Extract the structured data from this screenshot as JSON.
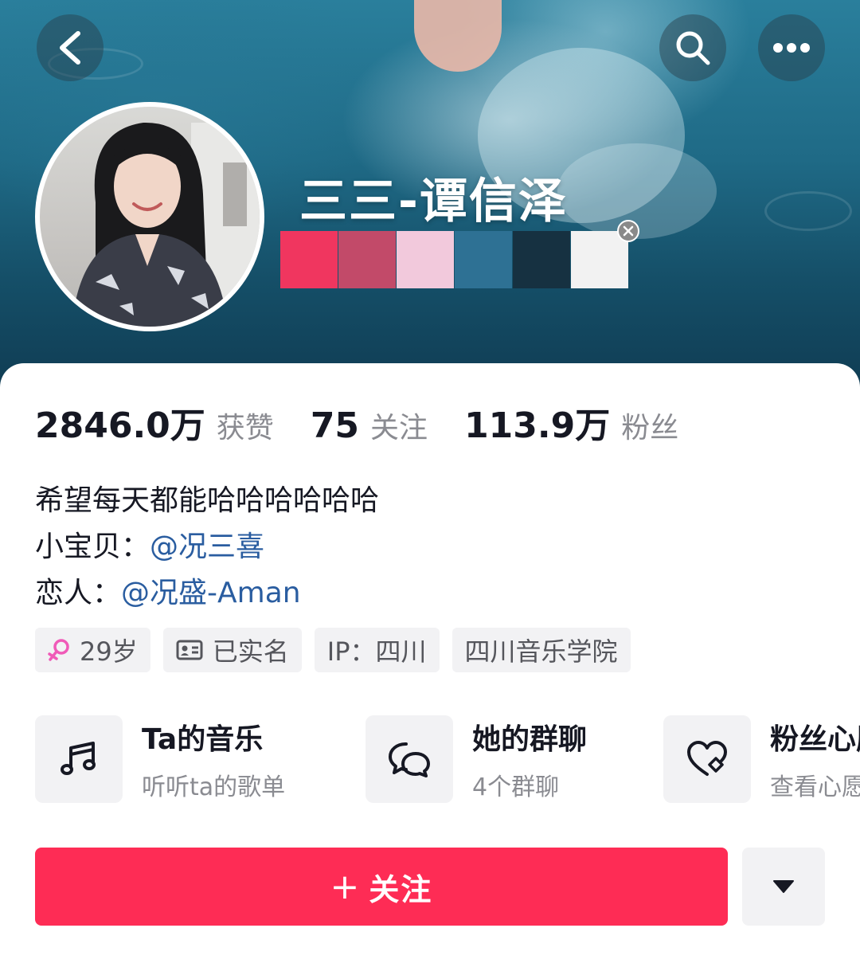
{
  "header": {
    "nickname": "三三-谭信泽",
    "palette": [
      "#f0365f",
      "#c24a69",
      "#f2c9dc",
      "#2e7194",
      "#163141",
      "#f2f2f2"
    ]
  },
  "stats": [
    {
      "value": "2846.0万",
      "label": "获赞"
    },
    {
      "value": "75",
      "label": "关注"
    },
    {
      "value": "113.9万",
      "label": "粉丝"
    }
  ],
  "bio": {
    "line1": "希望每天都能哈哈哈哈哈哈",
    "line2_prefix": "小宝贝：",
    "line2_mention": "@况三喜",
    "line3_prefix": "恋人：",
    "line3_mention": "@况盛-Aman"
  },
  "tags": {
    "age": "29岁",
    "verified": "已实名",
    "ip": "IP：四川",
    "school": "四川音乐学院"
  },
  "features": [
    {
      "title": "Ta的音乐",
      "subtitle": "听听ta的歌单",
      "icon": "music-note-icon"
    },
    {
      "title": "她的群聊",
      "subtitle": "4个群聊",
      "icon": "chat-bubbles-icon"
    },
    {
      "title": "粉丝心愿",
      "subtitle": "查看心愿",
      "icon": "heart-wish-icon"
    }
  ],
  "actions": {
    "follow_label": "关注",
    "follow_plus": "+"
  },
  "colors": {
    "accent": "#fe2c55",
    "mention": "#2a5da0",
    "female_symbol": "#f05ab8"
  }
}
